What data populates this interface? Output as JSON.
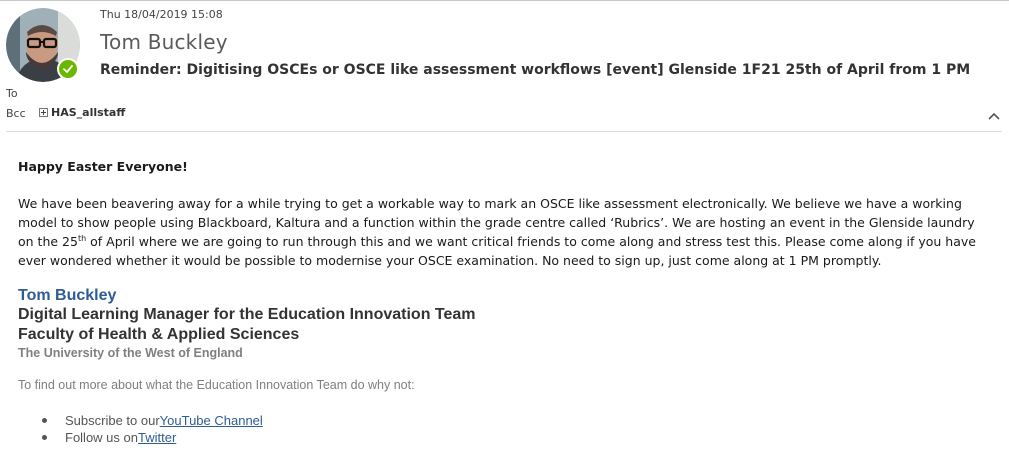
{
  "message": {
    "date": "Thu 18/04/2019 15:08",
    "sender": "Tom Buckley",
    "subject": "Reminder: Digitising OSCEs or OSCE like assessment workflows [event] Glenside 1F21 25th of April from 1 PM",
    "to_label": "To",
    "bcc_label": "Bcc",
    "bcc_recipient": "HAS_allstaff",
    "presence_color": "#6bb700"
  },
  "body": {
    "greeting": "Happy Easter Everyone!",
    "paragraph_part1": "We have been beavering away for a while trying to get a workable way to mark an OSCE like assessment electronically. We believe we have a working model to show people using Blackboard, Kaltura and a function within the grade centre called ‘Rubrics’. We are hosting an event in the Glenside laundry on the 25",
    "paragraph_sup": "th",
    "paragraph_part2": " of April where we are going to run through this and we want critical friends to come along and stress test this. Please come along if you have ever wondered whether it would be possible to modernise your OSCE examination. No need to sign up, just come along at 1 PM promptly."
  },
  "signature": {
    "name": "Tom Buckley",
    "role": "Digital Learning Manager for the Education Innovation Team",
    "faculty": "Faculty of Health & Applied Sciences",
    "university": "The University of the West of England",
    "find_out": "To find out more about what the Education Innovation Team do why not:",
    "links": [
      {
        "prefix": "Subscribe to our ",
        "link_text": "YouTube Channel"
      },
      {
        "prefix": "Follow us on ",
        "link_text": "Twitter"
      }
    ],
    "name_color": "#2e5c93"
  }
}
